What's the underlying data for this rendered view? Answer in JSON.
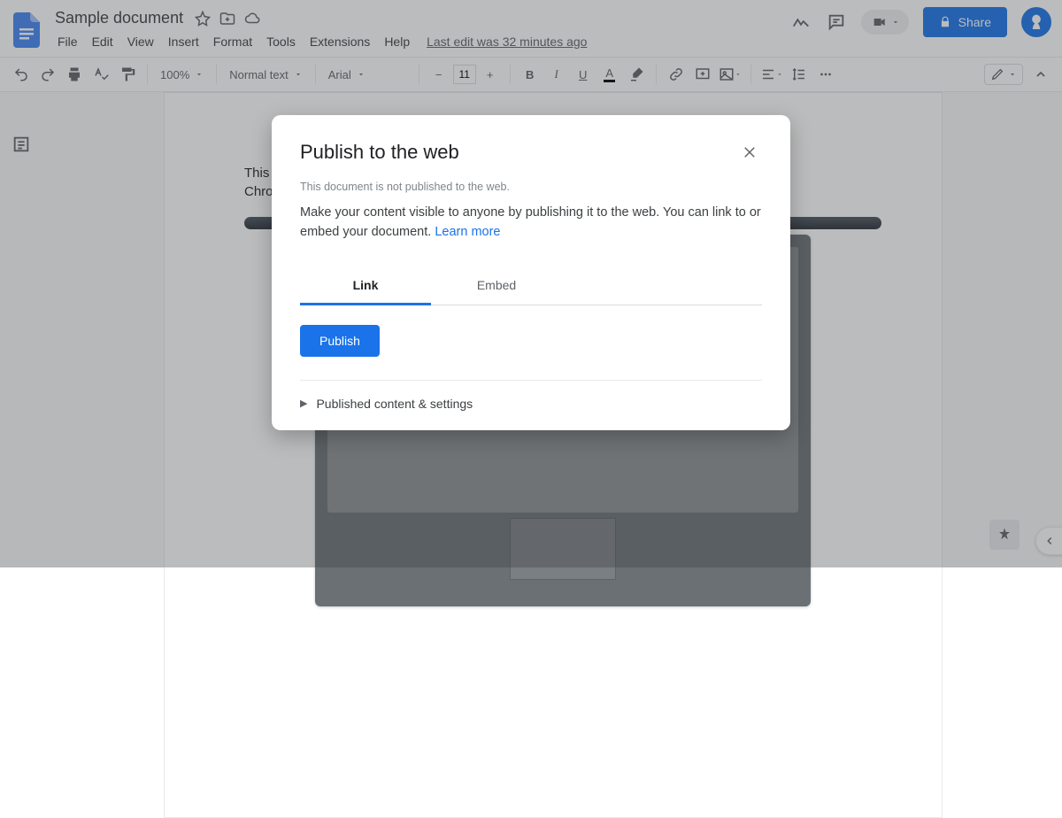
{
  "header": {
    "title": "Sample document",
    "last_edit": "Last edit was 32 minutes ago",
    "share_label": "Share"
  },
  "menu": {
    "file": "File",
    "edit": "Edit",
    "view": "View",
    "insert": "Insert",
    "format": "Format",
    "tools": "Tools",
    "extensions": "Extensions",
    "help": "Help"
  },
  "toolbar": {
    "zoom": "100%",
    "style": "Normal text",
    "font": "Arial",
    "font_size": "11"
  },
  "document": {
    "line1": "This is a",
    "line2": "Chromeb"
  },
  "dialog": {
    "title": "Publish to the web",
    "status": "This document is not published to the web.",
    "description": "Make your content visible to anyone by publishing it to the web. You can link to or embed your document. ",
    "learn_more": "Learn more",
    "tab_link": "Link",
    "tab_embed": "Embed",
    "publish": "Publish",
    "expander": "Published content & settings"
  }
}
